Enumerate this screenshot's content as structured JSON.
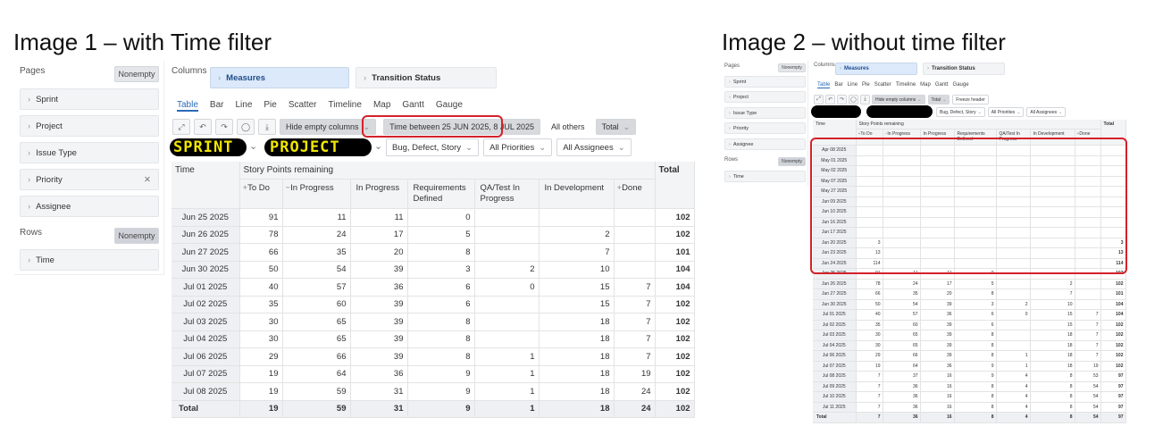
{
  "headings": {
    "image1": "Image 1 – with Time filter",
    "image2": "Image 2 – without time filter"
  },
  "panel": {
    "pages_label": "Pages",
    "rows_label": "Rows",
    "columns_label": "Columns",
    "nonempty_label": "Nonempty",
    "pages_items": [
      "Sprint",
      "Project",
      "Issue Type",
      "Priority",
      "Assignee"
    ],
    "rows_items": [
      "Time"
    ],
    "columns_items": [
      "Measures",
      "Transition Status"
    ]
  },
  "tabs": [
    "Table",
    "Bar",
    "Line",
    "Pie",
    "Scatter",
    "Timeline",
    "Map",
    "Gantt",
    "Gauge"
  ],
  "toolbar": {
    "hide_empty": "Hide empty columns",
    "time_filter": "Time between 25 JUN 2025, 8 JUL 2025",
    "all_others": "All others",
    "total": "Total",
    "freeze_header": "Freeze header"
  },
  "filters": {
    "sprint_handwritten": "SPRINT",
    "project_handwritten": "PROJECT",
    "issue_type": "Bug, Defect, Story",
    "priorities": "All Priorities",
    "assignees": "All Assignees"
  },
  "table": {
    "time_header": "Time",
    "group_header": "Story Points remaining",
    "total_header": "Total",
    "columns": [
      "To Do",
      "In Progress",
      "In Progress",
      "Requirements Defined",
      "QA/Test In Progress",
      "In Development",
      "Done"
    ],
    "total_row_label": "Total"
  },
  "image1_rows": [
    {
      "time": "Jun 25 2025",
      "v": [
        "91",
        "11",
        "11",
        "0",
        "",
        "",
        ""
      ],
      "total": "102"
    },
    {
      "time": "Jun 26 2025",
      "v": [
        "78",
        "24",
        "17",
        "5",
        "",
        "2",
        ""
      ],
      "total": "102"
    },
    {
      "time": "Jun 27 2025",
      "v": [
        "66",
        "35",
        "20",
        "8",
        "",
        "7",
        ""
      ],
      "total": "101"
    },
    {
      "time": "Jun 30 2025",
      "v": [
        "50",
        "54",
        "39",
        "3",
        "2",
        "10",
        ""
      ],
      "total": "104"
    },
    {
      "time": "Jul 01 2025",
      "v": [
        "40",
        "57",
        "36",
        "6",
        "0",
        "15",
        "7"
      ],
      "total": "104"
    },
    {
      "time": "Jul 02 2025",
      "v": [
        "35",
        "60",
        "39",
        "6",
        "",
        "15",
        "7"
      ],
      "total": "102"
    },
    {
      "time": "Jul 03 2025",
      "v": [
        "30",
        "65",
        "39",
        "8",
        "",
        "18",
        "7"
      ],
      "total": "102"
    },
    {
      "time": "Jul 04 2025",
      "v": [
        "30",
        "65",
        "39",
        "8",
        "",
        "18",
        "7"
      ],
      "total": "102"
    },
    {
      "time": "Jul 06 2025",
      "v": [
        "29",
        "66",
        "39",
        "8",
        "1",
        "18",
        "7"
      ],
      "total": "102"
    },
    {
      "time": "Jul 07 2025",
      "v": [
        "19",
        "64",
        "36",
        "9",
        "1",
        "18",
        "19"
      ],
      "total": "102"
    },
    {
      "time": "Jul 08 2025",
      "v": [
        "19",
        "59",
        "31",
        "9",
        "1",
        "18",
        "24"
      ],
      "total": "102"
    }
  ],
  "image1_total": {
    "v": [
      "19",
      "59",
      "31",
      "9",
      "1",
      "18",
      "24"
    ],
    "total": "102"
  },
  "image2_rows": [
    {
      "time": "Apr 08 2025",
      "v": [
        "",
        "",
        "",
        "",
        "",
        "",
        ""
      ],
      "total": ""
    },
    {
      "time": "May 01 2025",
      "v": [
        "",
        "",
        "",
        "",
        "",
        "",
        ""
      ],
      "total": ""
    },
    {
      "time": "May 02 2025",
      "v": [
        "",
        "",
        "",
        "",
        "",
        "",
        ""
      ],
      "total": ""
    },
    {
      "time": "May 07 2025",
      "v": [
        "",
        "",
        "",
        "",
        "",
        "",
        ""
      ],
      "total": ""
    },
    {
      "time": "May 27 2025",
      "v": [
        "",
        "",
        "",
        "",
        "",
        "",
        ""
      ],
      "total": ""
    },
    {
      "time": "Jun 09 2025",
      "v": [
        "",
        "",
        "",
        "",
        "",
        "",
        ""
      ],
      "total": ""
    },
    {
      "time": "Jun 10 2025",
      "v": [
        "",
        "",
        "",
        "",
        "",
        "",
        ""
      ],
      "total": ""
    },
    {
      "time": "Jun 16 2025",
      "v": [
        "",
        "",
        "",
        "",
        "",
        "",
        ""
      ],
      "total": ""
    },
    {
      "time": "Jun 17 2025",
      "v": [
        "",
        "",
        "",
        "",
        "",
        "",
        ""
      ],
      "total": ""
    },
    {
      "time": "Jun 20 2025",
      "v": [
        "3",
        "",
        "",
        "",
        "",
        "",
        ""
      ],
      "total": "3"
    },
    {
      "time": "Jun 23 2025",
      "v": [
        "13",
        "",
        "",
        "",
        "",
        "",
        ""
      ],
      "total": "13"
    },
    {
      "time": "Jun 24 2025",
      "v": [
        "114",
        "",
        "",
        "",
        "",
        "",
        ""
      ],
      "total": "114"
    },
    {
      "time": "Jun 25 2025",
      "v": [
        "91",
        "11",
        "11",
        "0",
        "",
        "",
        ""
      ],
      "total": "102"
    },
    {
      "time": "Jun 26 2025",
      "v": [
        "78",
        "24",
        "17",
        "5",
        "",
        "2",
        ""
      ],
      "total": "102"
    },
    {
      "time": "Jun 27 2025",
      "v": [
        "66",
        "35",
        "20",
        "8",
        "",
        "7",
        ""
      ],
      "total": "101"
    },
    {
      "time": "Jun 30 2025",
      "v": [
        "50",
        "54",
        "39",
        "3",
        "2",
        "10",
        ""
      ],
      "total": "104"
    },
    {
      "time": "Jul 01 2025",
      "v": [
        "40",
        "57",
        "36",
        "6",
        "0",
        "15",
        "7"
      ],
      "total": "104"
    },
    {
      "time": "Jul 02 2025",
      "v": [
        "35",
        "60",
        "39",
        "6",
        "",
        "15",
        "7"
      ],
      "total": "102"
    },
    {
      "time": "Jul 03 2025",
      "v": [
        "30",
        "65",
        "39",
        "8",
        "",
        "18",
        "7"
      ],
      "total": "102"
    },
    {
      "time": "Jul 04 2025",
      "v": [
        "30",
        "65",
        "39",
        "8",
        "",
        "18",
        "7"
      ],
      "total": "102"
    },
    {
      "time": "Jul 06 2025",
      "v": [
        "29",
        "66",
        "39",
        "8",
        "1",
        "18",
        "7"
      ],
      "total": "102"
    },
    {
      "time": "Jul 07 2025",
      "v": [
        "19",
        "64",
        "36",
        "9",
        "1",
        "18",
        "19"
      ],
      "total": "102"
    },
    {
      "time": "Jul 08 2025",
      "v": [
        "7",
        "37",
        "16",
        "9",
        "4",
        "8",
        "53"
      ],
      "total": "97"
    },
    {
      "time": "Jul 09 2025",
      "v": [
        "7",
        "36",
        "16",
        "8",
        "4",
        "8",
        "54"
      ],
      "total": "97"
    },
    {
      "time": "Jul 10 2025",
      "v": [
        "7",
        "36",
        "16",
        "8",
        "4",
        "8",
        "54"
      ],
      "total": "97"
    },
    {
      "time": "Jul 11 2025",
      "v": [
        "7",
        "36",
        "16",
        "8",
        "4",
        "8",
        "54"
      ],
      "total": "97"
    }
  ],
  "image2_total": {
    "v": [
      "7",
      "36",
      "16",
      "8",
      "4",
      "8",
      "54"
    ],
    "total": "97"
  },
  "colors": {
    "highlight": "#d4212a",
    "active_tab": "#2a6bb8",
    "measures_bg": "#dce9fb"
  }
}
